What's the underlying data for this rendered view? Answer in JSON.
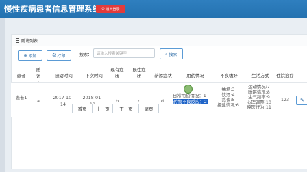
{
  "header": {
    "title": "慢性疾病患者信息管理系统",
    "logout_label": "退出登录"
  },
  "panel": {
    "title": "随访列表"
  },
  "toolbar": {
    "add_label": "添加",
    "print_label": "打印",
    "search_label": "搜索：",
    "search_placeholder": "请输入搜索关键字",
    "search_button": "搜索"
  },
  "table": {
    "headers": [
      "患者",
      "随访人",
      "随访时间",
      "下次时间",
      "现有症状",
      "既往症状",
      "新添症状",
      "用药情况",
      "不良嗜好",
      "生活方式",
      "住院治疗"
    ],
    "row": {
      "patient": "患者1",
      "visitor": "a",
      "visit_time": "2017-10-14",
      "next_time": "2018-01-12",
      "current": "b",
      "past": "c",
      "new": "d",
      "medication": [
        "日常用药情况：1",
        "药物不良反应：2"
      ],
      "habits": [
        "抽烟:3",
        "饮酒:4",
        "熬夜:5",
        "摄盐情况:6"
      ],
      "lifestyle": [
        "运动情况:7",
        "睡眠情况:8",
        "生气频率:9",
        "心理调整:10",
        "遵医行为:11"
      ],
      "hospital": "123"
    }
  },
  "pagination": [
    "首页",
    "上一页",
    "下一页",
    "尾页"
  ]
}
